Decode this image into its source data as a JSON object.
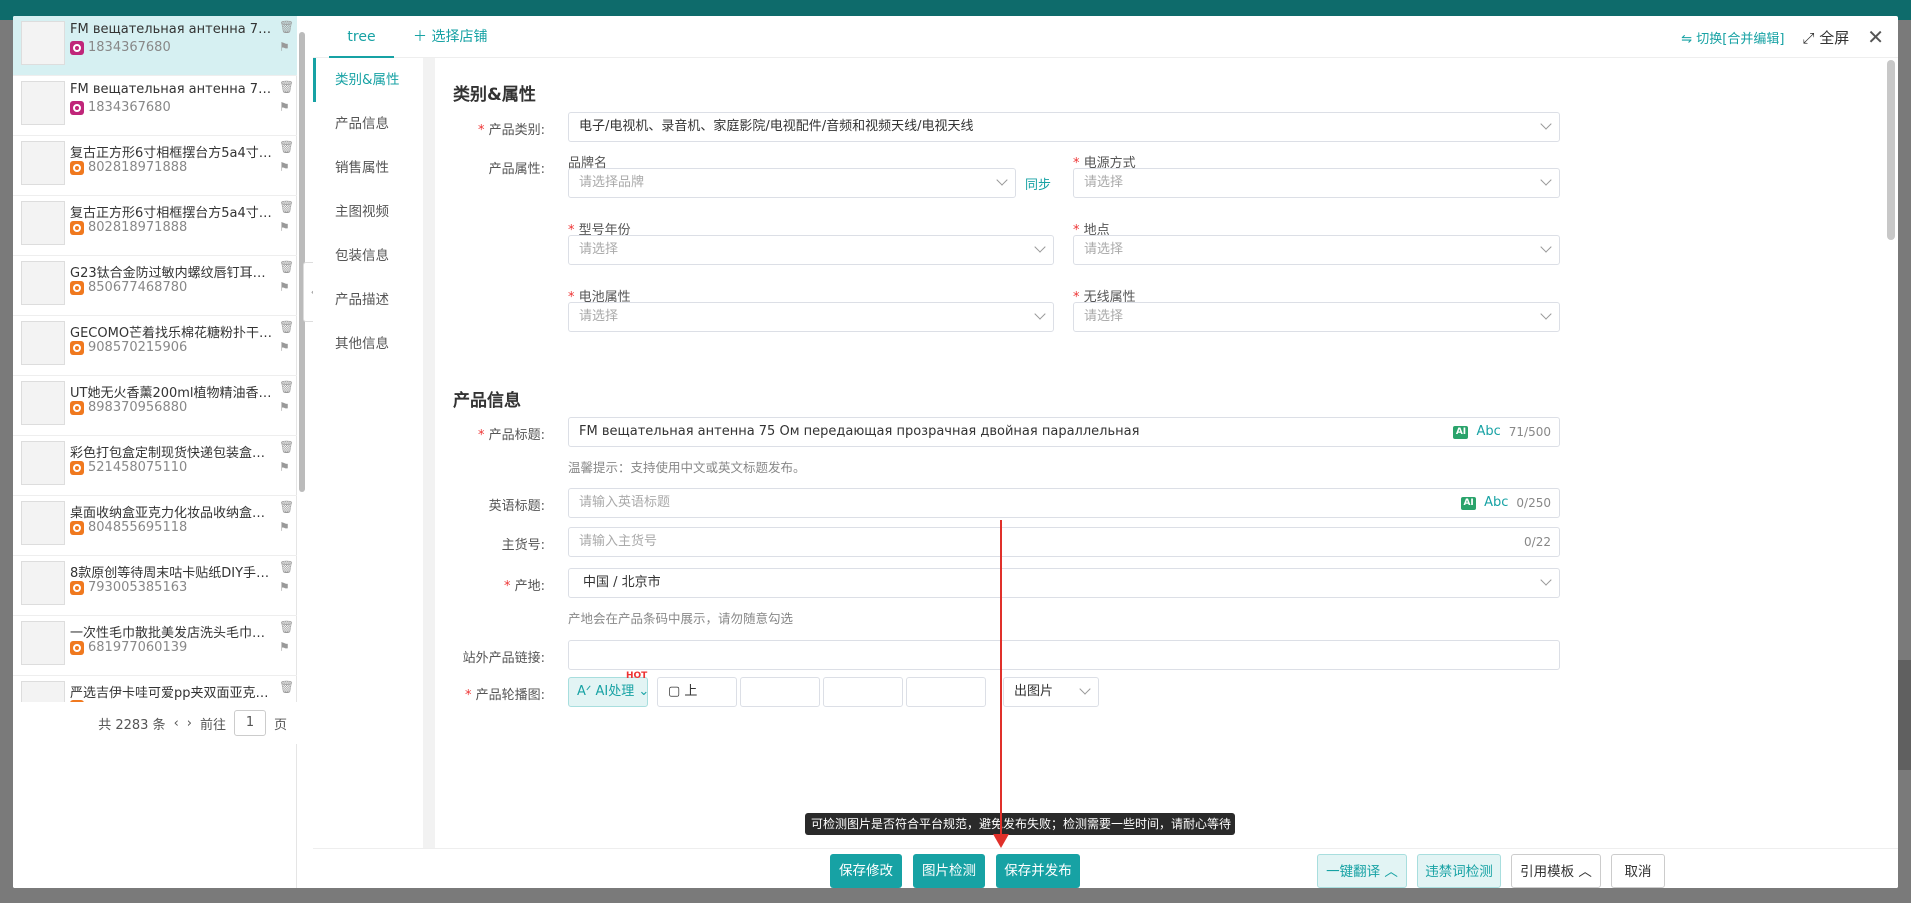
{
  "products": [
    {
      "title": "FM вещательная антенна 75 Ом пе...",
      "id": "1834367680",
      "shop": "ozon"
    },
    {
      "title": "FM вещательная антенна 75 Ом пе...",
      "id": "1834367680",
      "shop": "ozon"
    },
    {
      "title": "复古正方形6寸相框摆台方5a4寸10寸美...",
      "id": "802818971888",
      "shop": "ali"
    },
    {
      "title": "复古正方形6寸相框摆台方5a4寸10寸美...",
      "id": "802818971888",
      "shop": "ali"
    },
    {
      "title": "G23钛合金防过敏内螺纹唇钉耳骨钉人...",
      "id": "850677468780",
      "shop": "ali"
    },
    {
      "title": "GECOMO芒着找乐棉花糖粉扑干湿两用...",
      "id": "908570215906",
      "shop": "ali"
    },
    {
      "title": "UT她无火香薰200ml植物精油香薰卧室...",
      "id": "898370956880",
      "shop": "ali"
    },
    {
      "title": "彩色打包盒定制现货快递包装盒子批发...",
      "id": "521458075110",
      "shop": "ali"
    },
    {
      "title": "桌面收纳盒亚克力化妆品收纳盒透明零...",
      "id": "804855695118",
      "shop": "ali"
    },
    {
      "title": "8款原创等待周末咕卡贴纸DIY手账小卡...",
      "id": "793005385163",
      "shop": "ali"
    },
    {
      "title": "一次性毛巾散批美发店洗头毛巾足浴店...",
      "id": "681977060139",
      "shop": "ali"
    },
    {
      "title": "严选吉伊卡哇可爱pp夹双面亚克力便签...",
      "id": "",
      "shop": "ali"
    }
  ],
  "pager": {
    "total": "共 2283 条",
    "goto": "前往",
    "page": "1",
    "unit": "页"
  },
  "tabs": {
    "tree": "tree",
    "select_shop": "选择店铺"
  },
  "top": {
    "switch": "切换[合并编辑]",
    "fullscreen": "全屏"
  },
  "nav": [
    "类别&属性",
    "产品信息",
    "销售属性",
    "主图视频",
    "包装信息",
    "产品描述",
    "其他信息"
  ],
  "sec1": {
    "title": "类别&属性",
    "category_label": "产品类别:",
    "category_value": "电子/电视机、录音机、家庭影院/电视配件/音频和视频天线/电视天线",
    "attr_label": "产品属性:",
    "brand_label": "品牌名",
    "brand_ph": "请选择品牌",
    "sync": "同步",
    "power_label": "电源方式",
    "model_year_label": "型号年份",
    "location_label": "地点",
    "battery_label": "电池属性",
    "wireless_label": "无线属性",
    "select_ph": "请选择"
  },
  "sec2": {
    "title": "产品信息",
    "title_label": "产品标题:",
    "title_value": "FM вещательная антенна 75 Ом передающая прозрачная двойная параллельная",
    "title_count": "71/500",
    "title_hint": "温馨提示：支持使用中文或英文标题发布。",
    "en_label": "英语标题:",
    "en_ph": "请输入英语标题",
    "en_count": "0/250",
    "sku_label": "主货号:",
    "sku_ph": "请输入主货号",
    "sku_count": "0/22",
    "origin_label": "产地:",
    "origin_value": "中国 / 北京市",
    "origin_hint": "产地会在产品条码中展示，请勿随意勾选",
    "ext_label": "站外产品链接:",
    "carousel_label": "产品轮播图:",
    "ai_btn": "AI处理",
    "hot": "HOT",
    "upload_btn": "上",
    "export_btn": "出图片"
  },
  "ai_badge": "AI",
  "abc": "Abc",
  "tooltip": "可检测图片是否符合平台规范，避免发布失败；检测需要一些时间，请耐心等待",
  "footer": {
    "save": "保存修改",
    "check": "图片检测",
    "save_publish": "保存并发布",
    "translate": "一键翻译",
    "banned": "违禁词检测",
    "template": "引用模板",
    "cancel": "取消"
  },
  "colors": {
    "accent": "#17a2a4",
    "required": "#e33",
    "ozon": "#c0267a",
    "ali": "#f0791f"
  }
}
